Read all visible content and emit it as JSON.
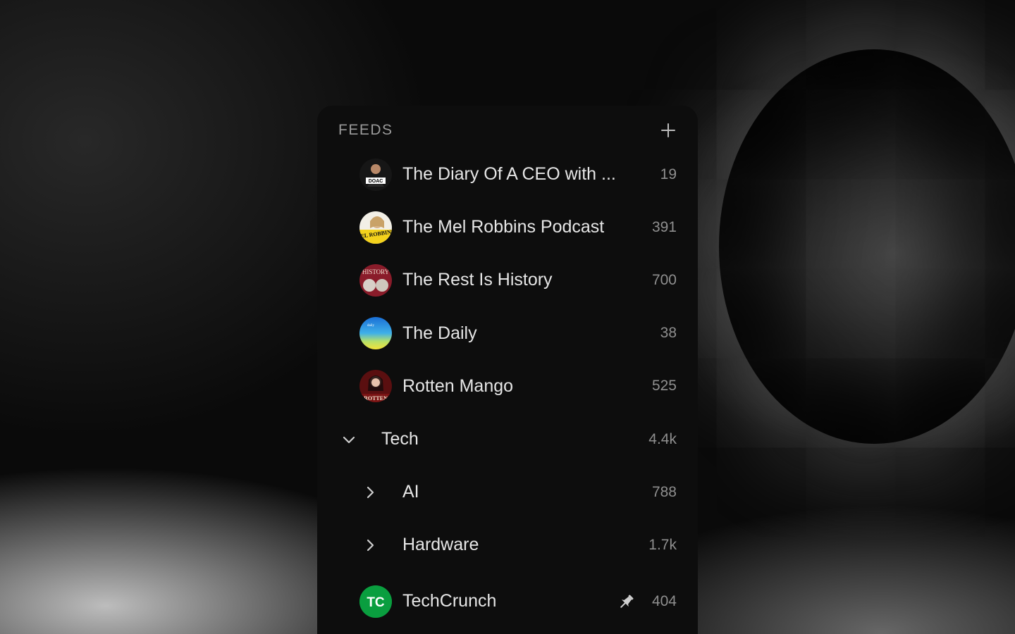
{
  "feeds_panel": {
    "title": "FEEDS",
    "add_icon": "plus-icon"
  },
  "podcasts": [
    {
      "name": "The Diary Of A CEO with ...",
      "count": "19",
      "avatar_text": "DOAC"
    },
    {
      "name": "The Mel Robbins Podcast",
      "count": "391",
      "avatar_text": "MEL ROBBINS"
    },
    {
      "name": "The Rest Is History",
      "count": "700",
      "avatar_text": "HISTORY"
    },
    {
      "name": "The Daily",
      "count": "38",
      "avatar_text": "daily"
    },
    {
      "name": "Rotten Mango",
      "count": "525",
      "avatar_text": "ROTTEN"
    }
  ],
  "folder": {
    "name": "Tech",
    "count": "4.4k",
    "icon": "chevron-down-icon",
    "subfolders": [
      {
        "name": "AI",
        "count": "788",
        "icon": "chevron-right-icon"
      },
      {
        "name": "Hardware",
        "count": "1.7k",
        "icon": "chevron-right-icon"
      }
    ],
    "feeds": [
      {
        "name": "TechCrunch",
        "count": "404",
        "logo_text": "TC",
        "pinned": true,
        "pin_icon": "pin-icon",
        "brand_color": "#0a9e3f"
      }
    ]
  }
}
